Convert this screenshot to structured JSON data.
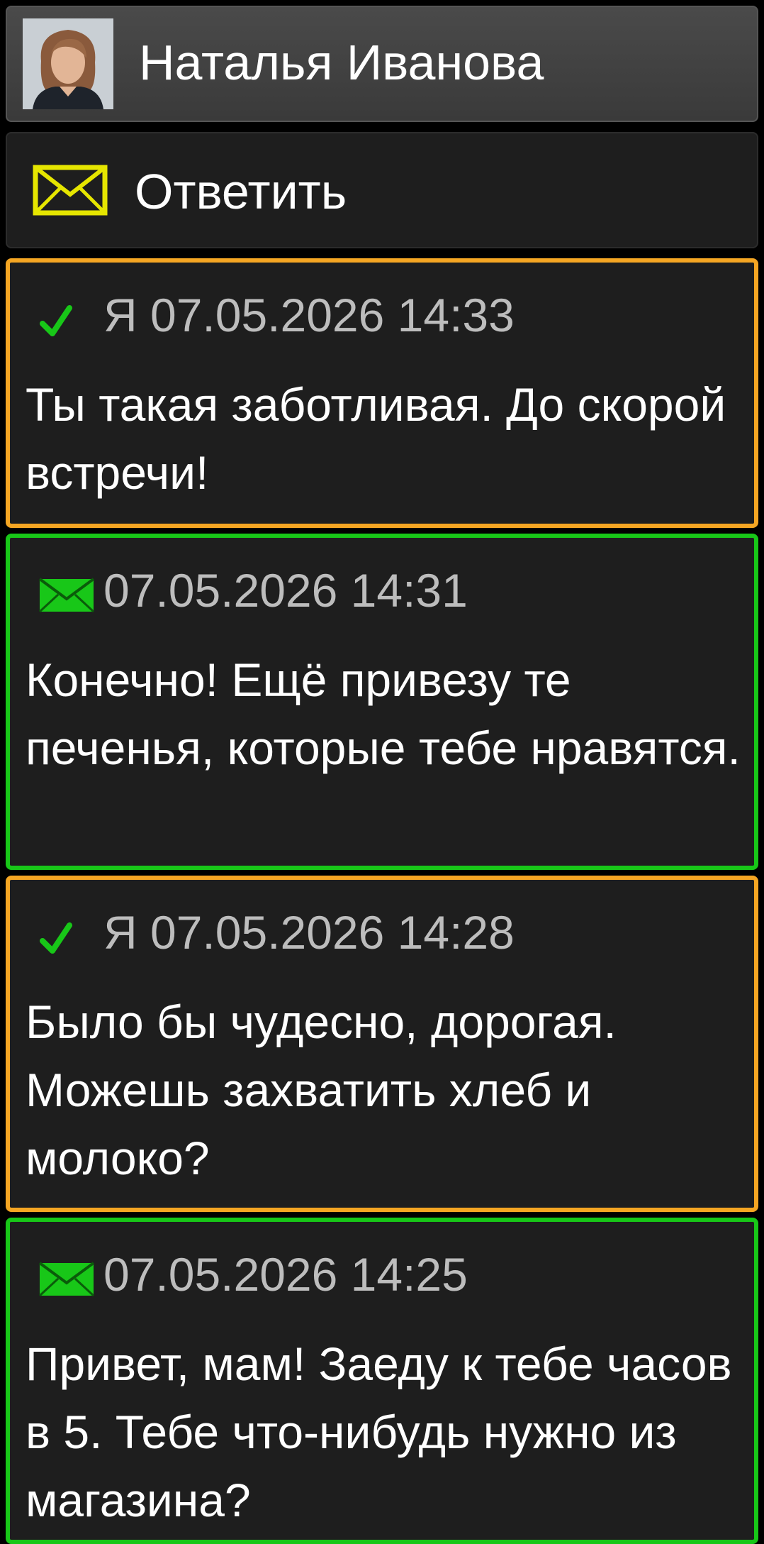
{
  "contact": {
    "name": "Наталья Иванова"
  },
  "reply": {
    "label": "Ответить",
    "icon": "envelope-icon",
    "icon_color": "#e6e600"
  },
  "colors": {
    "sent_border": "#f5a623",
    "received_border": "#18c718",
    "card_background": "#1e1e1e",
    "meta_text": "#bdbdbd",
    "body_text": "#ffffff"
  },
  "messages": [
    {
      "direction": "sent",
      "status_icon": "checkmark-icon",
      "meta": "Я 07.05.2026 14:33",
      "text": "Ты такая заботливая. До скорой встречи!"
    },
    {
      "direction": "received",
      "status_icon": "envelope-icon",
      "meta": "07.05.2026 14:31",
      "text": "Конечно! Ещё привезу те печенья, которые тебе нравятся."
    },
    {
      "direction": "sent",
      "status_icon": "checkmark-icon",
      "meta": "Я 07.05.2026 14:28",
      "text": "Было бы чудесно, дорогая. Можешь захватить хлеб и молоко?"
    },
    {
      "direction": "received",
      "status_icon": "envelope-icon",
      "meta": "07.05.2026 14:25",
      "text": "Привет, мам! Заеду к тебе часов в 5. Тебе что-нибудь нужно из магазина?"
    }
  ]
}
